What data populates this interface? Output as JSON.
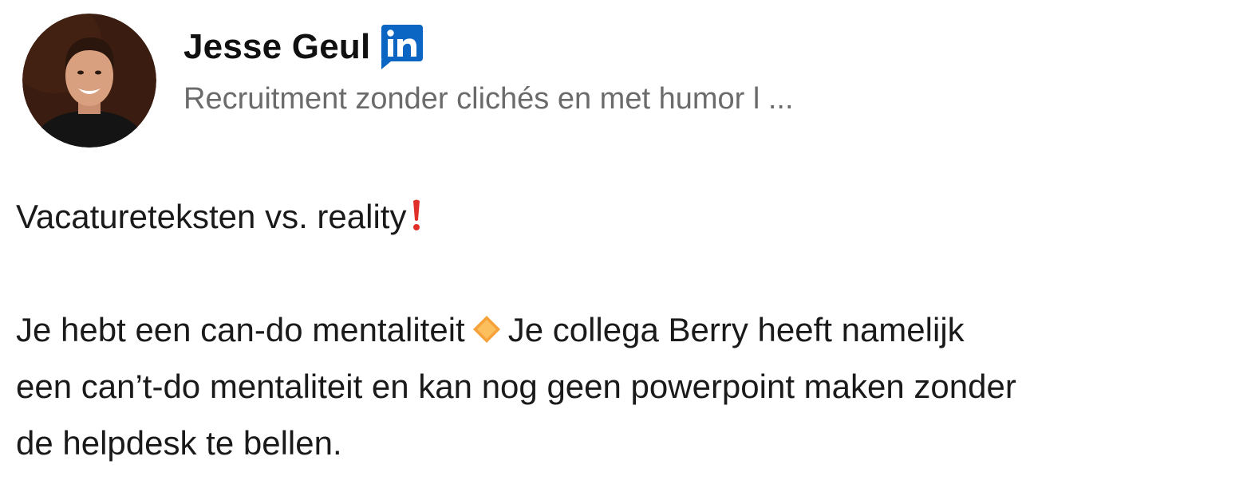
{
  "author": {
    "name": "Jesse Geul",
    "headline": "Recruitment zonder clichés en met humor l ...",
    "badge_icon": "linkedin-icon",
    "avatar_icon": "profile-photo"
  },
  "post": {
    "title_text": "Vacatureteksten vs. reality",
    "title_emoji": "exclamation-mark-icon",
    "line1_part1": "Je hebt een can-do mentaliteit",
    "line1_emoji": "orange-diamond-icon",
    "line1_part2": "Je collega Berry heeft namelijk",
    "line2": "een can’t-do mentaliteit en kan nog geen powerpoint maken zonder",
    "line3": "de helpdesk te bellen."
  },
  "colors": {
    "linkedin_blue": "#0a66c2",
    "headline_gray": "#6b6b6b",
    "text": "#1a1a1a",
    "exclamation_red": "#e0302a",
    "diamond_orange": "#f7a13a"
  }
}
